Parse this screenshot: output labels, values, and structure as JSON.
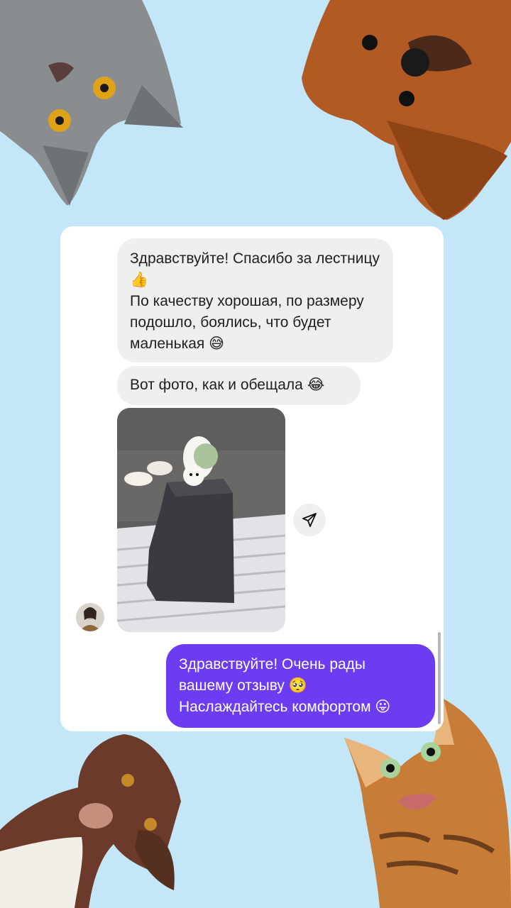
{
  "colors": {
    "background": "#c3e7f9",
    "incoming_bubble": "#efefef",
    "outgoing_bubble": "#6c3cf2",
    "card": "#ffffff"
  },
  "messages": {
    "incoming_1": "Здравствуйте! Спасибо за лестницу 👍\nПо качеству хорошая, по размеру подошло, боялись, что будет маленькая 😅",
    "incoming_2": "Вот фото, как и обещала 😂",
    "outgoing_1": "Здравствуйте! Очень рады вашему отзыву 🥺\nНаслаждайтесь комфортом 😛"
  },
  "icons": {
    "share": "paper-plane-icon",
    "avatar": "sender-avatar",
    "photo": "dog-on-pet-stairs-photo"
  }
}
